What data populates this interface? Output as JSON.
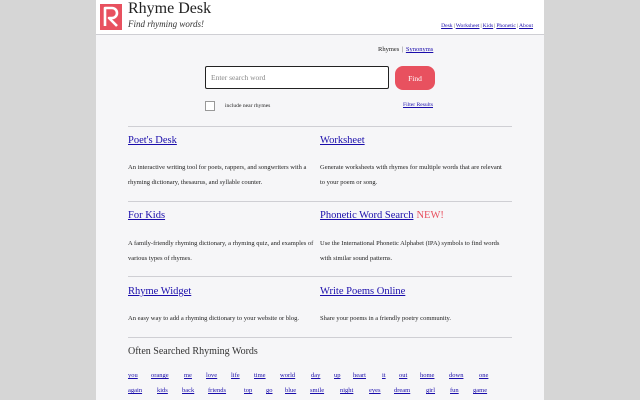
{
  "site": {
    "title": "Rhyme Desk",
    "tagline": "Find rhyming words!",
    "nav": [
      "Desk",
      "Worksheet",
      "Kids",
      "Phonetic",
      "About"
    ],
    "nav_separator": "|",
    "brand_color": "#e8515f"
  },
  "search": {
    "modes": [
      "Rhymes",
      "Synonyms"
    ],
    "mode_separator": "|",
    "placeholder": "Enter search word",
    "button_label": "Find",
    "near_rhymes_label": "include near rhymes",
    "near_rhymes_checked": false,
    "filter_label": "Filter Results"
  },
  "cards": [
    {
      "title": "Poet's Desk",
      "badge": "",
      "desc": "An interactive writing tool for poets, rappers, and songwriters with a rhyming dictionary, thesaurus, and syllable counter."
    },
    {
      "title": "Worksheet",
      "badge": "",
      "desc": "Generate worksheets with rhymes for multiple words that are relevant to your poem or song."
    },
    {
      "title": "For Kids",
      "badge": "",
      "desc": "A family-friendly rhyming dictionary, a rhyming quiz, and examples of various types of rhymes."
    },
    {
      "title": "Phonetic Word Search",
      "badge": "NEW!",
      "desc": "Use the International Phonetic Alphabet (IPA) symbols to find words with similar sound patterns."
    },
    {
      "title": "Rhyme Widget",
      "badge": "",
      "desc": "An easy way to add a rhyming dictionary to your website or blog."
    },
    {
      "title": "Write Poems Online",
      "badge": "",
      "desc": "Share your poems in a friendly poetry community."
    }
  ],
  "often_searched": {
    "title": "Often Searched Rhyming Words",
    "rows": [
      [
        "you",
        "orange",
        "me",
        "love",
        "life",
        "time",
        "world",
        "day",
        "up",
        "heart",
        "it",
        "out",
        "home",
        "down",
        "one"
      ],
      [
        "again",
        "kids",
        "back",
        "friends",
        "top",
        "go",
        "blue",
        "smile",
        "night",
        "eyes",
        "dream",
        "girl",
        "fun",
        "game"
      ]
    ]
  }
}
